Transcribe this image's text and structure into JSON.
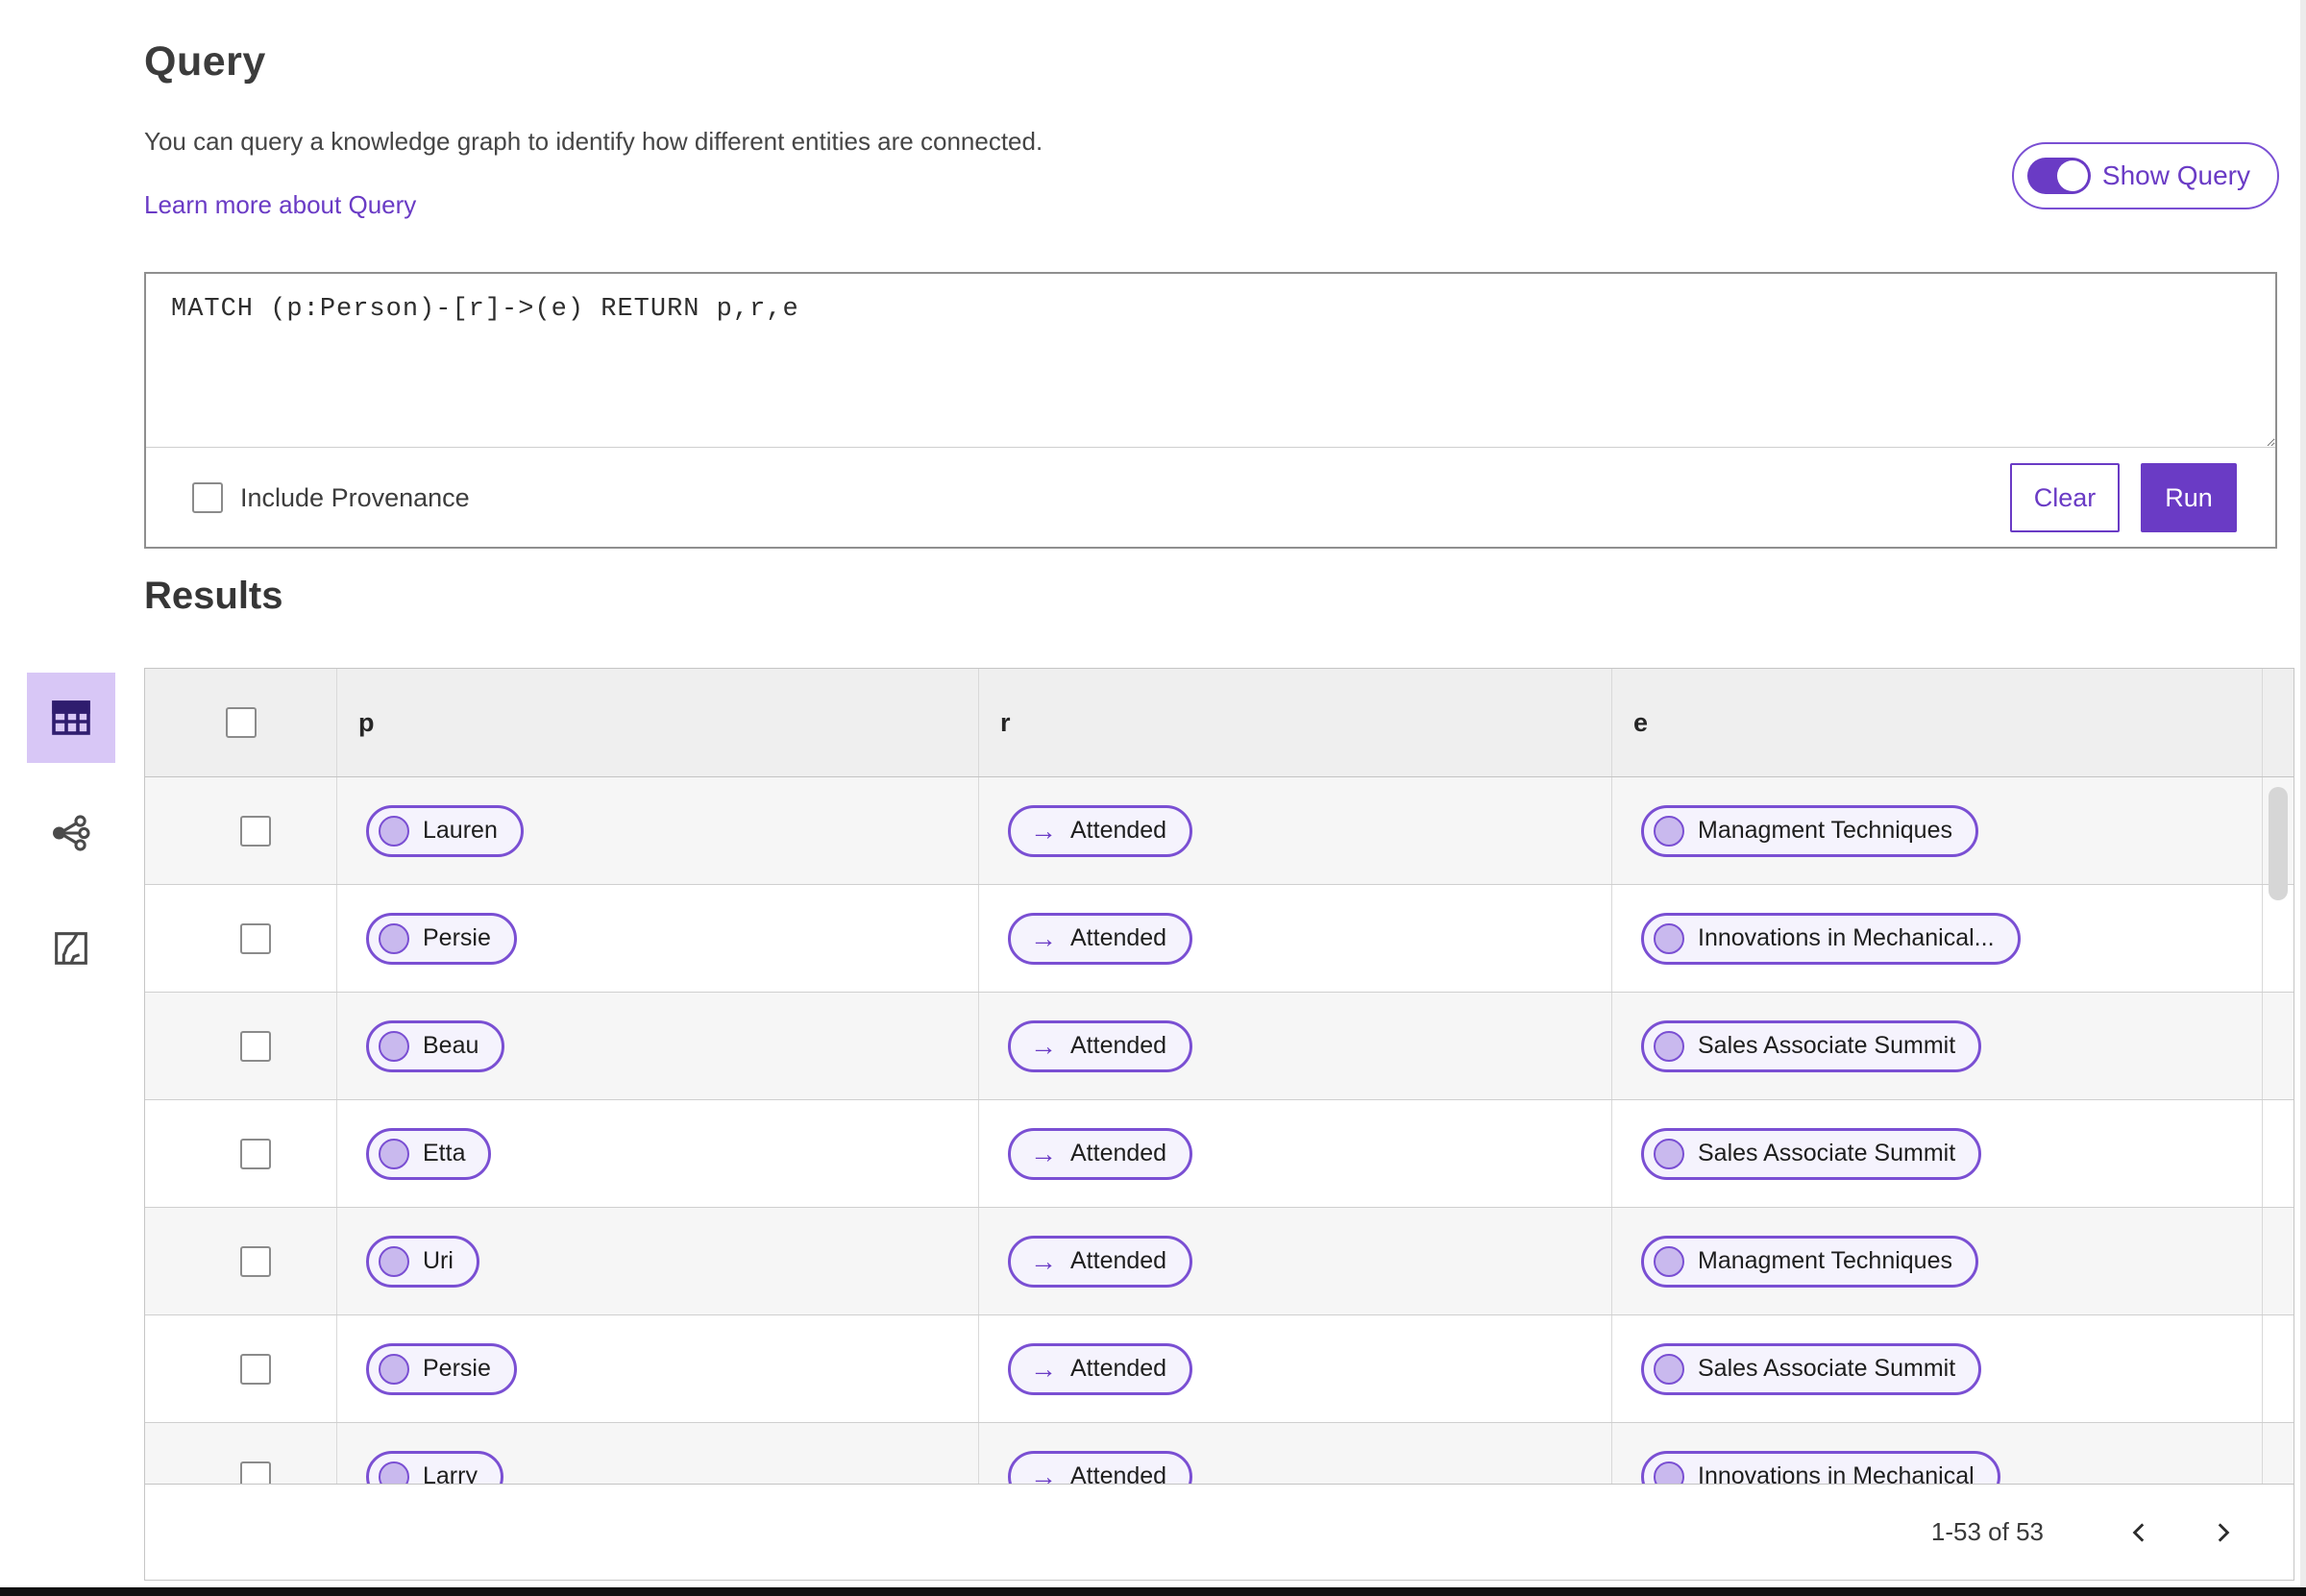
{
  "colors": {
    "accent": "#6a3bc5",
    "pill_border": "#7a4fd3",
    "pill_dot": "#c9b9ee"
  },
  "header": {
    "title": "Query",
    "description": "You can query a knowledge graph to identify how different entities are connected.",
    "learn_more_link": "Learn more about Query",
    "show_query_label": "Show Query",
    "show_query_on": true
  },
  "query_editor": {
    "query_text": "MATCH (p:Person)-[r]->(e) RETURN p,r,e",
    "include_provenance_label": "Include Provenance",
    "include_provenance_checked": false,
    "clear_label": "Clear",
    "run_label": "Run"
  },
  "results": {
    "title": "Results",
    "view_switcher": [
      {
        "name": "table-view",
        "icon": "table-icon",
        "selected": true
      },
      {
        "name": "graph-view",
        "icon": "network-icon",
        "selected": false
      },
      {
        "name": "chart-view",
        "icon": "chart-icon",
        "selected": false
      }
    ]
  },
  "table": {
    "columns": [
      "p",
      "r",
      "e"
    ],
    "relation_arrow": "→",
    "rows": [
      {
        "p": "Lauren",
        "r": "Attended",
        "e": "Managment Techniques"
      },
      {
        "p": "Persie",
        "r": "Attended",
        "e": "Innovations in Mechanical..."
      },
      {
        "p": "Beau",
        "r": "Attended",
        "e": "Sales Associate Summit"
      },
      {
        "p": "Etta",
        "r": "Attended",
        "e": "Sales Associate Summit"
      },
      {
        "p": "Uri",
        "r": "Attended",
        "e": "Managment Techniques"
      },
      {
        "p": "Persie",
        "r": "Attended",
        "e": "Sales Associate Summit"
      },
      {
        "p": "Larry",
        "r": "Attended",
        "e": "Innovations in Mechanical"
      }
    ]
  },
  "pagination": {
    "range_label": "1-53 of 53"
  }
}
